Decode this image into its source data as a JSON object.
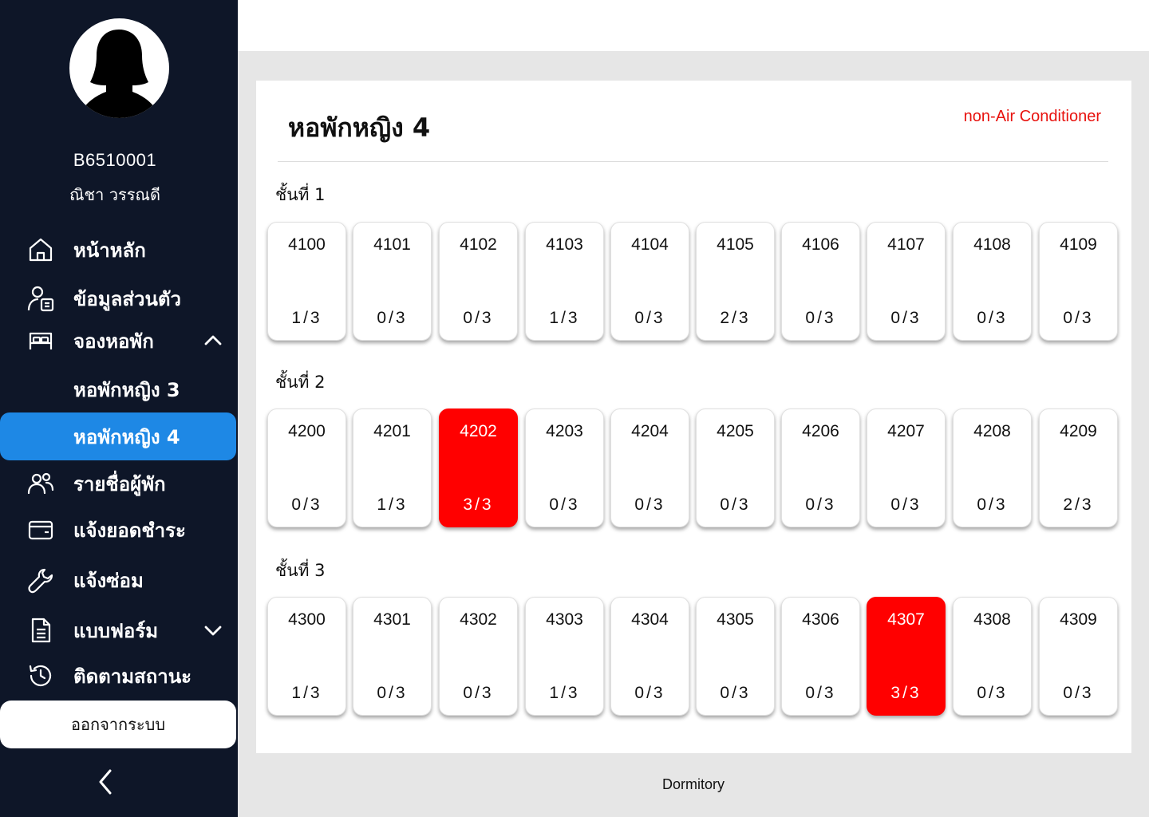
{
  "user": {
    "id": "B6510001",
    "name": "ณิชา วรรณดี"
  },
  "nav": {
    "home": "หน้าหลัก",
    "profile": "ข้อมูลส่วนตัว",
    "booking": "จองหอพัก",
    "dorm3": "หอพักหญิง 3",
    "dorm4": "หอพักหญิง 4",
    "residents": "รายชื่อผู้พัก",
    "payment": "แจ้งยอดชำระ",
    "repair": "แจ้งซ่อม",
    "forms": "แบบฟอร์ม",
    "status": "ติดตามสถานะ",
    "logout": "ออกจากระบบ"
  },
  "page": {
    "title": "หอพักหญิง 4",
    "badge": "non-Air Conditioner",
    "footer": "Dormitory"
  },
  "colors": {
    "sidebar": "#0e1628",
    "active": "#1e88e5",
    "full": "#ff0000",
    "badge": "#e8130f"
  },
  "floors": [
    {
      "label": "ชั้นที่ 1",
      "rooms": [
        {
          "number": "4100",
          "occupancy": "1/3",
          "full": false
        },
        {
          "number": "4101",
          "occupancy": "0/3",
          "full": false
        },
        {
          "number": "4102",
          "occupancy": "0/3",
          "full": false
        },
        {
          "number": "4103",
          "occupancy": "1/3",
          "full": false
        },
        {
          "number": "4104",
          "occupancy": "0/3",
          "full": false
        },
        {
          "number": "4105",
          "occupancy": "2/3",
          "full": false
        },
        {
          "number": "4106",
          "occupancy": "0/3",
          "full": false
        },
        {
          "number": "4107",
          "occupancy": "0/3",
          "full": false
        },
        {
          "number": "4108",
          "occupancy": "0/3",
          "full": false
        },
        {
          "number": "4109",
          "occupancy": "0/3",
          "full": false
        }
      ]
    },
    {
      "label": "ชั้นที่ 2",
      "rooms": [
        {
          "number": "4200",
          "occupancy": "0/3",
          "full": false
        },
        {
          "number": "4201",
          "occupancy": "1/3",
          "full": false
        },
        {
          "number": "4202",
          "occupancy": "3/3",
          "full": true
        },
        {
          "number": "4203",
          "occupancy": "0/3",
          "full": false
        },
        {
          "number": "4204",
          "occupancy": "0/3",
          "full": false
        },
        {
          "number": "4205",
          "occupancy": "0/3",
          "full": false
        },
        {
          "number": "4206",
          "occupancy": "0/3",
          "full": false
        },
        {
          "number": "4207",
          "occupancy": "0/3",
          "full": false
        },
        {
          "number": "4208",
          "occupancy": "0/3",
          "full": false
        },
        {
          "number": "4209",
          "occupancy": "2/3",
          "full": false
        }
      ]
    },
    {
      "label": "ชั้นที่ 3",
      "rooms": [
        {
          "number": "4300",
          "occupancy": "1/3",
          "full": false
        },
        {
          "number": "4301",
          "occupancy": "0/3",
          "full": false
        },
        {
          "number": "4302",
          "occupancy": "0/3",
          "full": false
        },
        {
          "number": "4303",
          "occupancy": "1/3",
          "full": false
        },
        {
          "number": "4304",
          "occupancy": "0/3",
          "full": false
        },
        {
          "number": "4305",
          "occupancy": "0/3",
          "full": false
        },
        {
          "number": "4306",
          "occupancy": "0/3",
          "full": false
        },
        {
          "number": "4307",
          "occupancy": "3/3",
          "full": true
        },
        {
          "number": "4308",
          "occupancy": "0/3",
          "full": false
        },
        {
          "number": "4309",
          "occupancy": "0/3",
          "full": false
        }
      ]
    }
  ]
}
